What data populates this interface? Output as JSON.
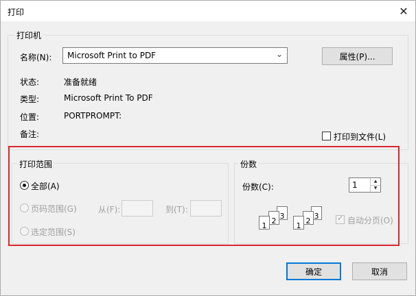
{
  "dialog": {
    "title": "打印",
    "close_glyph": "✕"
  },
  "printer": {
    "group_label": "打印机",
    "name_label": "名称(N):",
    "name_value": "Microsoft Print to PDF",
    "properties_button": "属性(P)...",
    "status_label": "状态:",
    "status_value": "准备就绪",
    "type_label": "类型:",
    "type_value": "Microsoft Print To PDF",
    "location_label": "位置:",
    "location_value": "PORTPROMPT:",
    "comment_label": "备注:",
    "print_to_file": "打印到文件(L)"
  },
  "range": {
    "group_label": "打印范围",
    "all": "全部(A)",
    "pages": "页码范围(G)",
    "from_label": "从(F):",
    "to_label": "到(T):",
    "selection": "选定范围(S)"
  },
  "copies": {
    "group_label": "份数",
    "count_label": "份数(C):",
    "count_value": "1",
    "collate": "自动分页(O)",
    "collate_pages": [
      "1",
      "2",
      "3"
    ]
  },
  "buttons": {
    "ok": "确定",
    "cancel": "取消"
  },
  "icons": {
    "dropdown": "chevron-down-icon",
    "spin_up": "arrow-up-icon",
    "spin_down": "arrow-down-icon"
  },
  "colors": {
    "highlight": "#d9262c",
    "default_button_border": "#0078d7"
  }
}
